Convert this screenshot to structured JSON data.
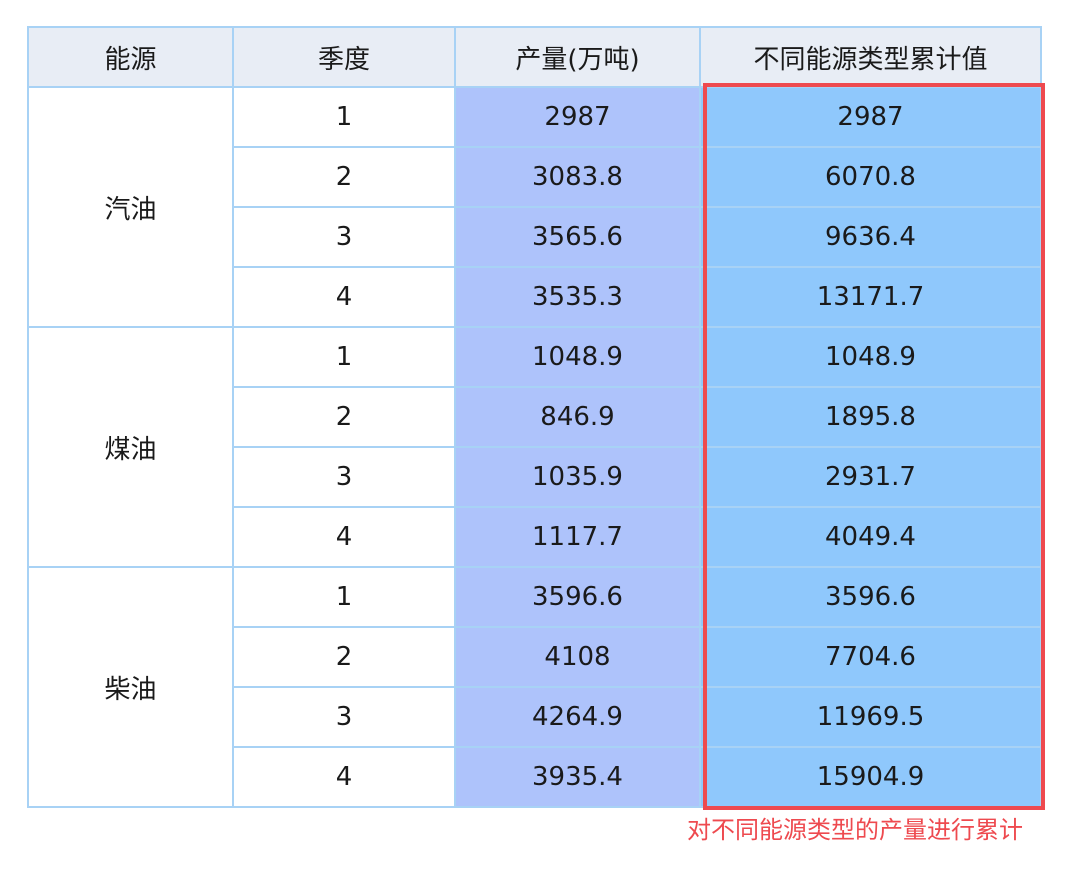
{
  "table": {
    "headers": [
      "能源",
      "季度",
      "产量(万吨)",
      "不同能源类型累计值"
    ],
    "groups": [
      {
        "energy": "汽油",
        "rows": [
          {
            "quarter": "1",
            "production": "2987",
            "cumulative": "2987"
          },
          {
            "quarter": "2",
            "production": "3083.8",
            "cumulative": "6070.8"
          },
          {
            "quarter": "3",
            "production": "3565.6",
            "cumulative": "9636.4"
          },
          {
            "quarter": "4",
            "production": "3535.3",
            "cumulative": "13171.7"
          }
        ]
      },
      {
        "energy": "煤油",
        "rows": [
          {
            "quarter": "1",
            "production": "1048.9",
            "cumulative": "1048.9"
          },
          {
            "quarter": "2",
            "production": "846.9",
            "cumulative": "1895.8"
          },
          {
            "quarter": "3",
            "production": "1035.9",
            "cumulative": "2931.7"
          },
          {
            "quarter": "4",
            "production": "1117.7",
            "cumulative": "4049.4"
          }
        ]
      },
      {
        "energy": "柴油",
        "rows": [
          {
            "quarter": "1",
            "production": "3596.6",
            "cumulative": "3596.6"
          },
          {
            "quarter": "2",
            "production": "4108",
            "cumulative": "7704.6"
          },
          {
            "quarter": "3",
            "production": "4264.9",
            "cumulative": "11969.5"
          },
          {
            "quarter": "4",
            "production": "3935.4",
            "cumulative": "15904.9"
          }
        ]
      }
    ]
  },
  "annotation": {
    "text": "对不同能源类型的产量进行累计",
    "color": "#ee4a4f"
  },
  "colors": {
    "header_bg": "#e8edf5",
    "production_bg": "#aec3fb",
    "cumulative_bg": "#8fc8fc",
    "border": "#a8d2f5"
  }
}
